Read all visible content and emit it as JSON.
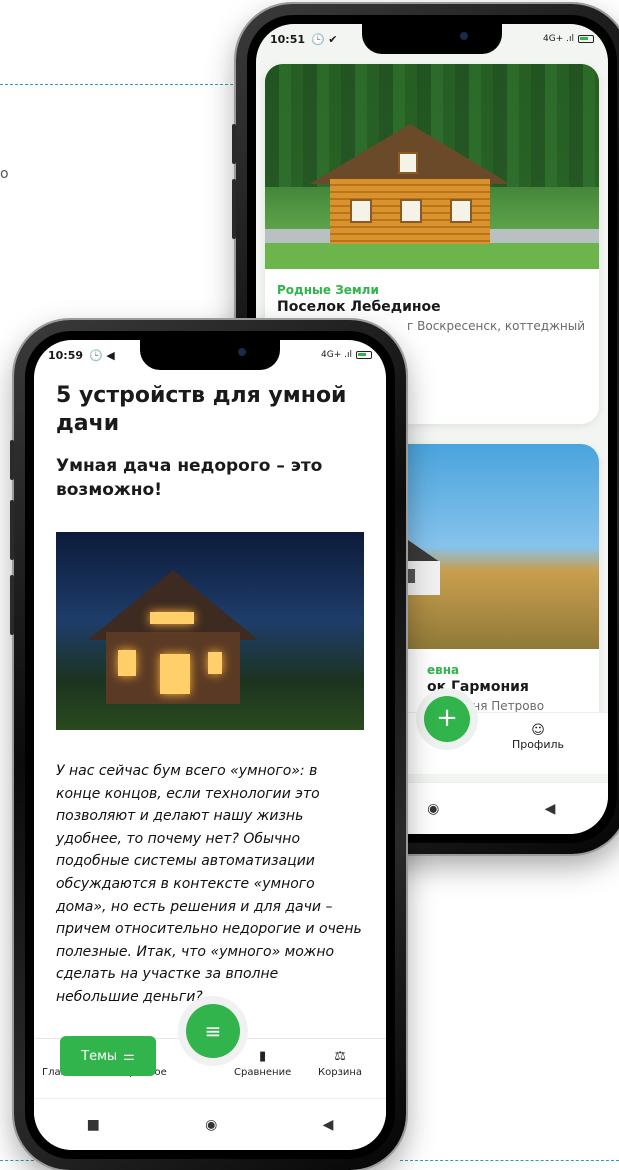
{
  "colors": {
    "accent": "#31b44b",
    "dash": "#2e9fb0"
  },
  "background": {
    "fragment_text": "о"
  },
  "back_phone": {
    "status": {
      "time": "10:51",
      "icons": "🕒 ✔",
      "signal": "4G+ .ıl"
    },
    "card1": {
      "brand": "Родные Земли",
      "title": "Поселок Лебединое",
      "subtitle": "г Воскресенск, коттеджный"
    },
    "card2": {
      "brand": "евна",
      "title": "ок Гармония",
      "subtitle": ", деревня Петрово"
    },
    "fab_label": "+",
    "nav": {
      "profile_label": "Профиль"
    },
    "system_nav": {
      "home": "◉",
      "back": "◀"
    }
  },
  "front_phone": {
    "status": {
      "time": "10:59",
      "icons": "🕒 ◀",
      "signal": "4G+ .ıl"
    },
    "article": {
      "title": "5 устройств для умной дачи",
      "subtitle": "Умная дача недорого – это возможно!",
      "body": "У нас сейчас бум всего «умного»: в конце концов, если технологии это позволяют и делают нашу жизнь удобнее, то почему нет? Обычно подобные системы автоматизации обсуждаются в контексте «умного дома», но есть решения и для дачи – причем относительно недорогие и очень полезные. Итак, что «умного» можно сделать на участке за вполне небольшие деньги?"
    },
    "themes_button": {
      "label": "Темы",
      "icon": "filter-icon"
    },
    "fab": {
      "icon": "search-list-icon",
      "glyph": "≡"
    },
    "nav": [
      {
        "label": "Главная",
        "icon": "home-icon",
        "glyph": "⌂"
      },
      {
        "label": "Избранное",
        "icon": "heart-icon",
        "glyph": "♡"
      },
      {
        "label": "Сравнение",
        "icon": "compare-icon",
        "glyph": "▮"
      },
      {
        "label": "Корзина",
        "icon": "basket-icon",
        "glyph": "⚖"
      }
    ],
    "system_nav": {
      "recent": "■",
      "home": "◉",
      "back": "◀"
    }
  }
}
